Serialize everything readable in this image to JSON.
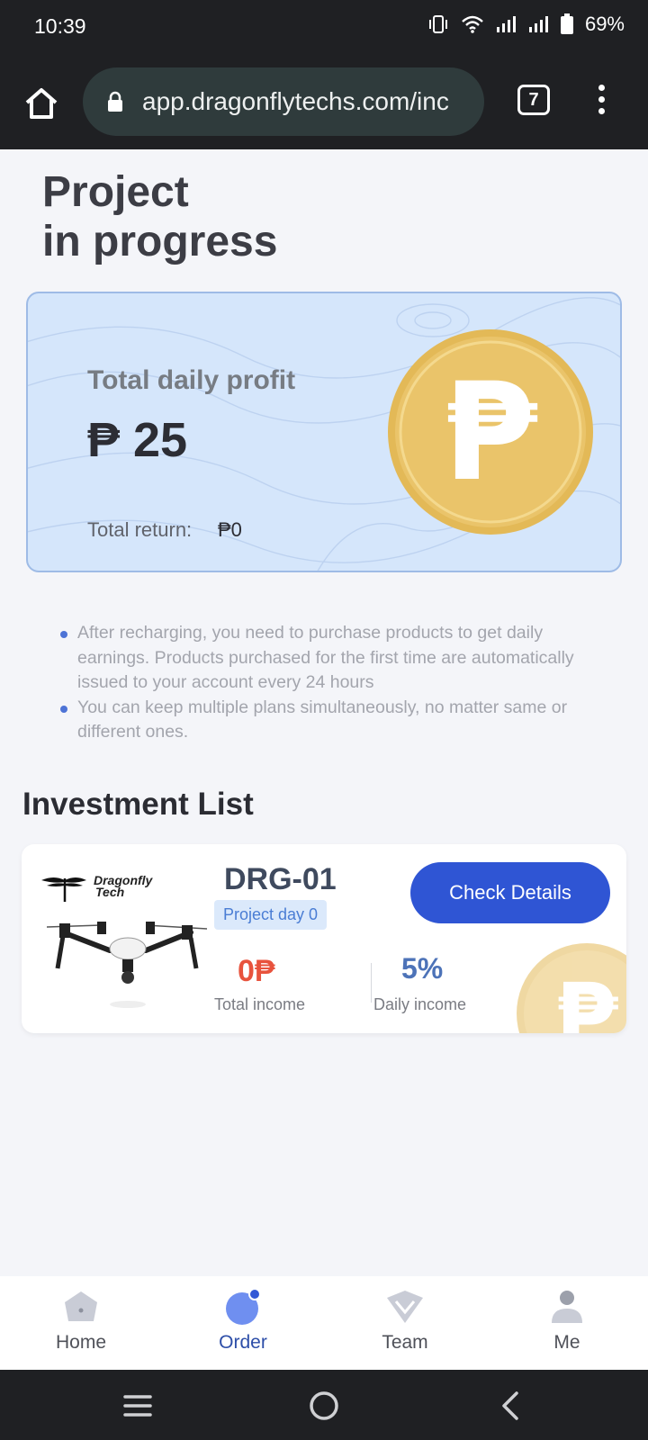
{
  "status_bar": {
    "time": "10:39",
    "battery": "69%"
  },
  "browser": {
    "url": "app.dragonflytechs.com/inc",
    "tab_count": "7"
  },
  "page": {
    "title_line1": "Project",
    "title_line2": "in progress"
  },
  "profit_card": {
    "label": "Total daily profit",
    "value": "₱ 25",
    "return_label": "Total return:",
    "return_value": "₱0",
    "coin_symbol": "₱"
  },
  "notes": [
    "After recharging, you need to purchase products to get daily earnings. Products purchased for the first time are automatically issued to your account every 24 hours",
    "You can keep multiple plans simultaneously, no matter same or different ones."
  ],
  "investment": {
    "section_title": "Investment List",
    "items": [
      {
        "brand_line1": "Dragonfly",
        "brand_line2": "Tech",
        "name": "DRG-01",
        "day_badge": "Project day 0",
        "button_label": "Check Details",
        "total_income": "0₱",
        "total_income_label": "Total income",
        "daily_income": "5%",
        "daily_income_label": "Daily income"
      }
    ]
  },
  "bottom_nav": {
    "items": [
      {
        "label": "Home",
        "icon": "home-icon"
      },
      {
        "label": "Order",
        "icon": "order-icon",
        "active": true
      },
      {
        "label": "Team",
        "icon": "team-icon"
      },
      {
        "label": "Me",
        "icon": "user-icon"
      }
    ]
  },
  "colors": {
    "accent": "#2f55d4",
    "income_red": "#e8533d",
    "card_blue": "#d5e6fb",
    "coin_gold": "#e8c063",
    "chrome": "#1f2023"
  }
}
